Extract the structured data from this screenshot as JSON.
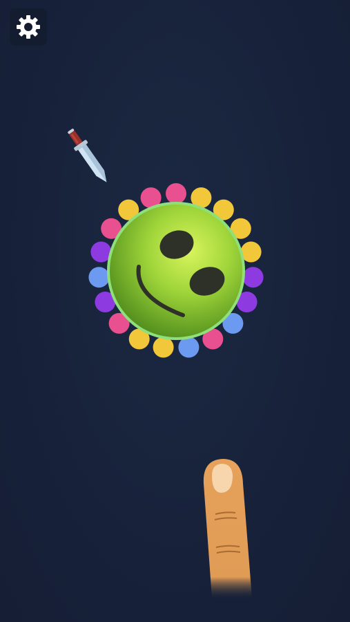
{
  "game": {
    "background_color": "#18233a",
    "settings": {
      "icon": "gear-icon",
      "color": "#ffffff"
    },
    "knife": {
      "icon": "knife-icon",
      "blade_color": "#cfe3f3",
      "handle_color": "#9b2f2a",
      "guard_color": "#b8c8d6"
    },
    "target": {
      "face": "smiling-green-ball",
      "face_color": "#8fd03a",
      "rim_color": "#3f7a1e",
      "balls": [
        {
          "color": "#e8508f"
        },
        {
          "color": "#f2c73a"
        },
        {
          "color": "#f2c73a"
        },
        {
          "color": "#f2c73a"
        },
        {
          "color": "#f2c73a"
        },
        {
          "color": "#8d3be0"
        },
        {
          "color": "#8d3be0"
        },
        {
          "color": "#6b9af0"
        },
        {
          "color": "#e8508f"
        },
        {
          "color": "#6b9af0"
        },
        {
          "color": "#f2c73a"
        },
        {
          "color": "#f2c73a"
        },
        {
          "color": "#e8508f"
        },
        {
          "color": "#8d3be0"
        },
        {
          "color": "#6b9af0"
        },
        {
          "color": "#8d3be0"
        },
        {
          "color": "#e8508f"
        },
        {
          "color": "#f2c73a"
        },
        {
          "color": "#e8508f"
        }
      ]
    },
    "tutorial_hint": {
      "icon": "tap-finger-icon",
      "skin_color": "#e6a25a"
    }
  }
}
